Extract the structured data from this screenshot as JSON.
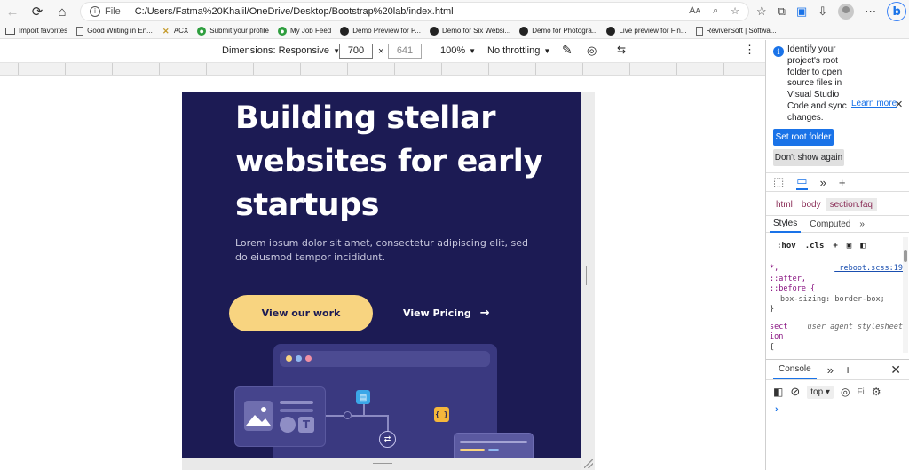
{
  "browser": {
    "address_prefix": "File",
    "url": "C:/Users/Fatma%20Khalil/OneDrive/Desktop/Bootstrap%20lab/index.html",
    "addr_icons": [
      "Aᴀ",
      "☆",
      "⊕"
    ],
    "favorites": [
      {
        "label": "Import favorites",
        "icon": "import-icon"
      },
      {
        "label": "Good Writing in En...",
        "icon": "page-icon"
      },
      {
        "label": "ACX",
        "icon": "acx-icon"
      },
      {
        "label": "Submit your profile",
        "icon": "globe-icon"
      },
      {
        "label": "My Job Feed",
        "icon": "globe-icon"
      },
      {
        "label": "Demo Preview for P...",
        "icon": "dark-icon"
      },
      {
        "label": "Demo for Six Websi...",
        "icon": "dark-icon"
      },
      {
        "label": "Demo for Photogra...",
        "icon": "dark-icon"
      },
      {
        "label": "Live preview for Fin...",
        "icon": "dark-icon"
      },
      {
        "label": "ReviverSoft | Softwa...",
        "icon": "page-icon"
      }
    ]
  },
  "devbar": {
    "dimensions": "Dimensions: Responsive",
    "width": "700",
    "height": "641",
    "times": "×",
    "zoom": "100%",
    "throttle": "No throttling",
    "more": "⋮"
  },
  "page": {
    "title": "Building stellar websites for early startups",
    "subtitle": "Lorem ipsum dolor sit amet, consectetur adipiscing elit, sed do eiusmod tempor incididunt.",
    "btn_work": "View our work",
    "btn_pricing": "View Pricing",
    "arrow": "→",
    "icon_T": "T",
    "icon_braces": "{ }"
  },
  "devtools": {
    "message": "Identify your project's root folder to open source files in Visual Studio Code and sync changes.",
    "learn_more": "Learn more",
    "set_root": "Set root folder",
    "dont_show": "Don't show again",
    "crumbs": [
      "html",
      "body",
      "section.faq"
    ],
    "style_tabs": [
      "Styles",
      "Computed"
    ],
    "filter": [
      ":hov",
      ".cls"
    ],
    "css": {
      "sel1": "*,",
      "sel2": "::after,",
      "sel3": "::before {",
      "src1": "_reboot.scss:19",
      "prop1": "box-sizing: border-box;",
      "close1": "}",
      "sel4": "sect",
      "sel4b": "ion",
      "src2": "user agent stylesheet",
      "brace": "{"
    },
    "console_tab": "Console",
    "context": "top",
    "filter_ph": "Fi",
    "prompt": "›"
  },
  "colors": {
    "page_bg": "#1c1b54",
    "accent_button": "#f8d480",
    "link_blue": "#1a73e8"
  }
}
